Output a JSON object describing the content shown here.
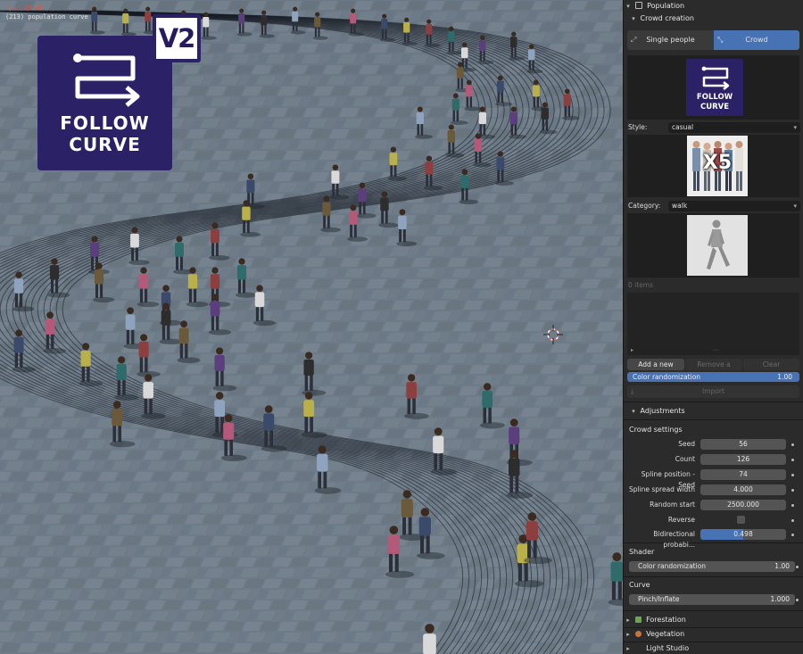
{
  "viewport": {
    "fps_text": "fps: 23.80",
    "object_text": "(213) population curve",
    "logo": {
      "line1": "FOLLOW",
      "line2": "CURVE",
      "badge": "V2"
    }
  },
  "panel": {
    "population": {
      "title": "Population"
    },
    "crowd_creation": {
      "title": "Crowd creation",
      "tab_single": "Single people",
      "tab_crowd": "Crowd",
      "logo_line1": "FOLLOW",
      "logo_line2": "CURVE",
      "style_label": "Style:",
      "style_value": "casual",
      "style_thumb_text": "X5",
      "category_label": "Category:",
      "category_value": "walk",
      "items_count": "0 items",
      "add_person": "Add a new person",
      "remove_person": "Remove a person",
      "clear": "Clear",
      "color_randomization_label": "Color randomization",
      "color_randomization_value": "1.00",
      "import": "Import"
    },
    "adjustments": {
      "title": "Adjustments",
      "crowd_settings": "Crowd settings",
      "fields": [
        {
          "label": "Seed",
          "value": "56"
        },
        {
          "label": "Count",
          "value": "126"
        },
        {
          "label": "Spline position - Seed",
          "value": "74"
        },
        {
          "label": "Spline spread width",
          "value": "4.000"
        },
        {
          "label": "Random start",
          "value": "2500.000"
        },
        {
          "label": "Reverse",
          "value": ""
        },
        {
          "label": "Bidirectional probabi...",
          "value": "0.498",
          "fill": 0.498
        }
      ],
      "shader_title": "Shader",
      "shader_color_label": "Color randomization",
      "shader_color_value": "1.00",
      "curve_title": "Curve",
      "pinch_label": "Pinch/Inflate",
      "pinch_value": "1.000"
    },
    "sections": [
      "Forestation",
      "Vegetation",
      "Light Studio"
    ],
    "colors": {
      "accent": "#4772b3",
      "logo_bg": "#2a2166"
    }
  }
}
